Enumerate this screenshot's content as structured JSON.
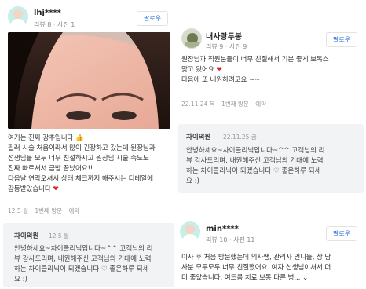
{
  "left_review": {
    "username": "lhj****",
    "stats": "리뷰 8 · 사진 1",
    "follow_label": "팔로우",
    "photo_icon": "face-photo",
    "text_lines": [
      "여기는 진짜 강추입니다 👍",
      "필러 시술 처음이라서 많이 긴장하고 갔는데 원장님과",
      "선생님들 모두 너무 친절하시고 원장님 시술 속도도",
      "진짜 빠르셔서 금방 끝났어요!!",
      "다음날 연락오셔서 상태 체크까지 해주시는 디테일에",
      "감동받았습니다"
    ],
    "heart": "❤",
    "date": "12.5 월",
    "visit": "1번째 방문",
    "reservation": "예약",
    "reply": {
      "name": "차이의원",
      "date": "12.5 월",
      "lines": [
        "안녕하세요~차이클리닉입니다~^^ 고객님의 리",
        "뷰 감사드리며, 내원해주신 고객님의 기대에 노력",
        "하는 차이클리닉이 되겠습니다 ♡ 좋은하루 되세",
        "요 :)"
      ]
    }
  },
  "right_review_1": {
    "username": "내사랑두봉",
    "stats": "리뷰 9 · 사진 9",
    "follow_label": "팔로우",
    "text_lines": [
      "원장님과 직원분들이 너무 친절해서 기분 좋게 보톡스",
      "맞고 왔어요",
      "다음에 또 내원하려고요 ~~"
    ],
    "heart": "❤",
    "date": "22.11.24 목",
    "visit": "1번째 방문",
    "reservation": "예약",
    "reply": {
      "name": "차이의원",
      "date": "22.11.25 금",
      "lines": [
        "안녕하세요~차이클리닉입니다~^^ 고객님의 리",
        "뷰 감사드리며, 내원해주신 고객님의 기대에 노력",
        "하는 차이클리닉이 되겠습니다 ♡ 좋은하루 되세",
        "요 :)"
      ]
    }
  },
  "right_review_2": {
    "username": "min****",
    "stats": "리뷰 10 · 사진 11",
    "follow_label": "팔로우",
    "text_lines": [
      "이사 후 처음 방문했는데 의사쌤, 관리사 언니들, 상 담",
      "사분 모두모두 너무 친절했어요. 여자 선생님이셔서 더",
      "더 좋았습니다. 여드름 치료 보통 다른 병..."
    ],
    "expand_icon": "chevron-down-icon"
  }
}
